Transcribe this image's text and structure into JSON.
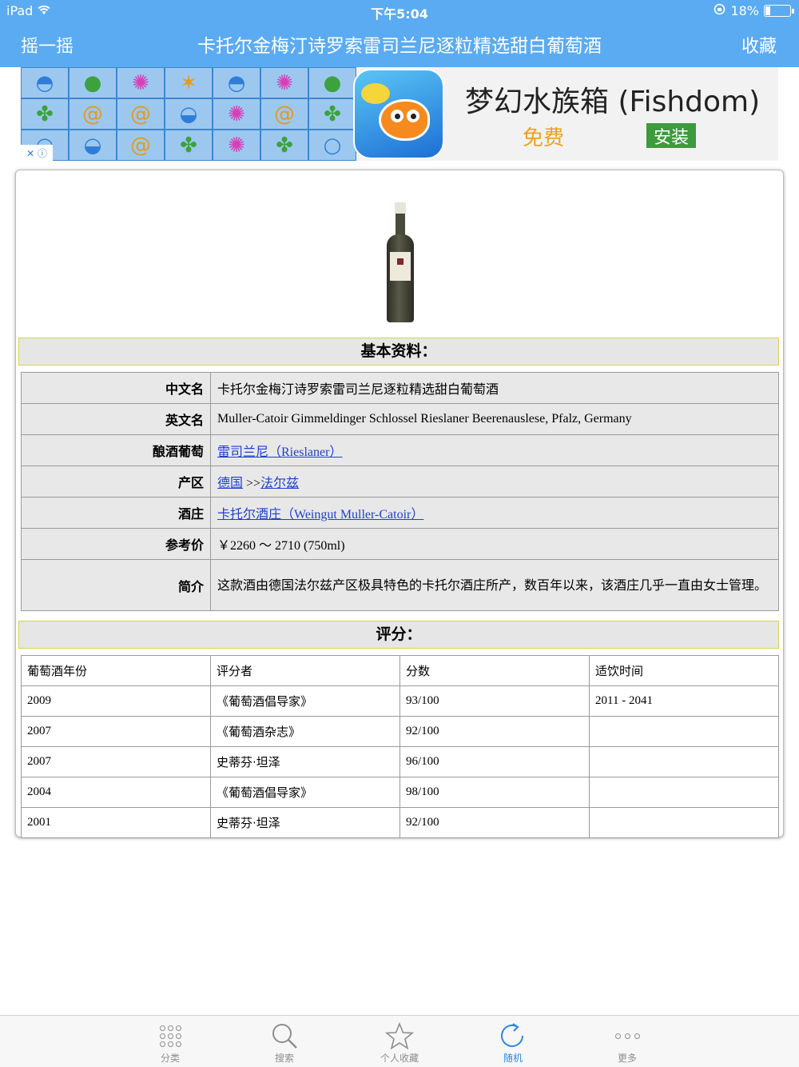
{
  "status": {
    "device": "iPad",
    "time": "下午5:04",
    "battery": "18%",
    "battery_level": 0.18
  },
  "nav": {
    "left": "摇一摇",
    "title": "卡托尔金梅汀诗罗索雷司兰尼逐粒精选甜白葡萄酒",
    "right": "收藏"
  },
  "ad": {
    "app_name": "梦幻水族箱 (Fishdom)",
    "price": "免费",
    "install": "安装"
  },
  "sections": {
    "basic": "基本资料：",
    "ratings": "评分："
  },
  "info": {
    "cn_name_key": "中文名",
    "cn_name": "卡托尔金梅汀诗罗索雷司兰尼逐粒精选甜白葡萄酒",
    "en_name_key": "英文名",
    "en_name": "Muller-Catoir Gimmeldinger Schlossel Rieslaner Beerenauslese, Pfalz, Germany",
    "grape_key": "酿酒葡萄",
    "grape": "雷司兰尼（Rieslaner）",
    "region_key": "产区",
    "region_country": "德国",
    "region_sep": " >>",
    "region_sub": "法尔兹",
    "winery_key": "酒庄",
    "winery": "卡托尔酒庄（Weingut Muller-Catoir）",
    "price_key": "参考价",
    "price": "￥2260 ～ 2710 (750ml)",
    "intro_key": "简介",
    "intro": "这款酒由德国法尔兹产区极具特色的卡托尔酒庄所产，数百年以来，该酒庄几乎一直由女士管理。"
  },
  "scores": {
    "headers": [
      "葡萄酒年份",
      "评分者",
      "分数",
      "适饮时间"
    ],
    "rows": [
      [
        "2009",
        "《葡萄酒倡导家》",
        "93/100",
        "2011 - 2041"
      ],
      [
        "2007",
        "《葡萄酒杂志》",
        "92/100",
        ""
      ],
      [
        "2007",
        "史蒂芬·坦泽",
        "96/100",
        ""
      ],
      [
        "2004",
        "《葡萄酒倡导家》",
        "98/100",
        ""
      ],
      [
        "2001",
        "史蒂芬·坦泽",
        "92/100",
        ""
      ]
    ]
  },
  "tabs": [
    "分类",
    "搜索",
    "个人收藏",
    "随机",
    "更多"
  ],
  "colors": {
    "nav_bg": "#5aabf2",
    "link": "#1f3fcf",
    "active_tab": "#2a86e8",
    "section_border": "#d6d64a"
  }
}
